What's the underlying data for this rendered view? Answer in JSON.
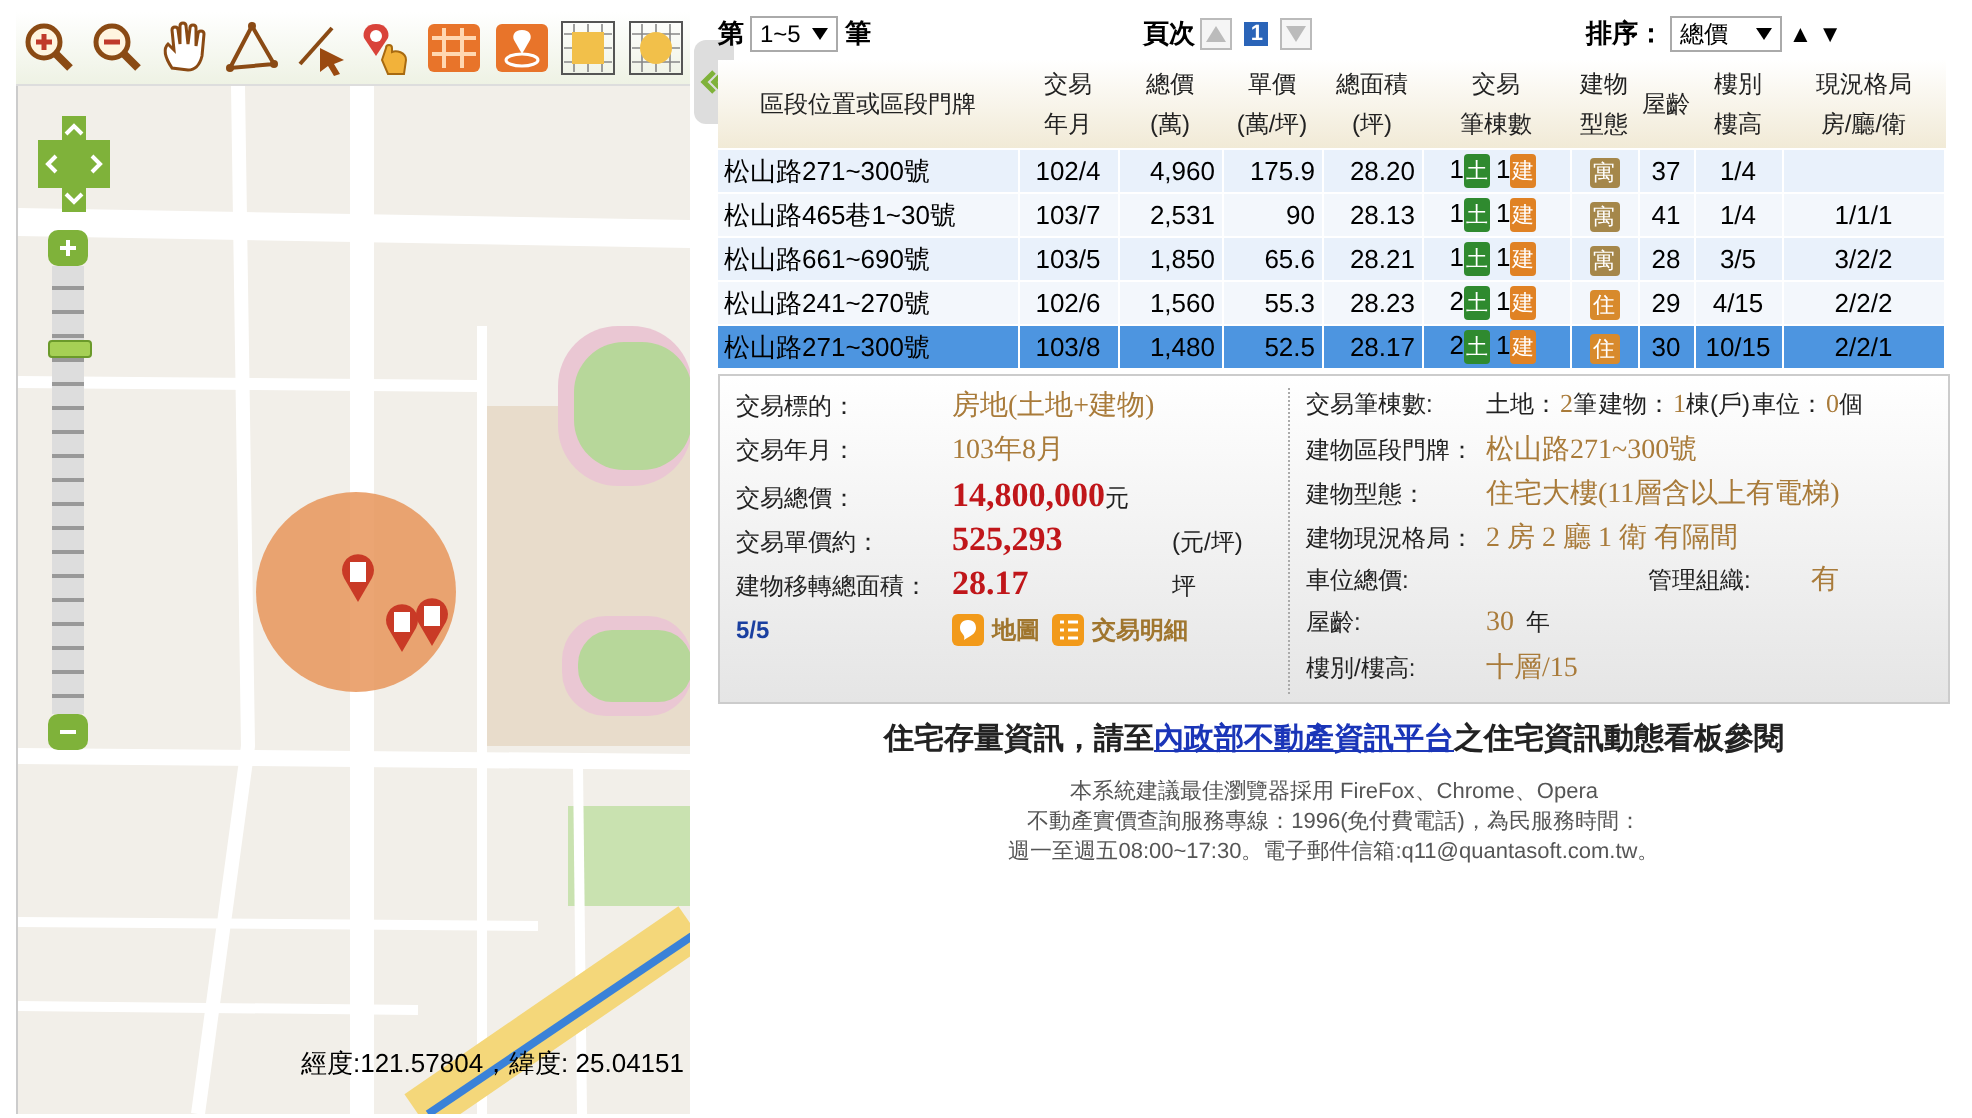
{
  "map": {
    "zoom_slider": {
      "level": 0.83
    },
    "coordinates": "經度:121.57804，緯度: 25.04151"
  },
  "listing_controls": {
    "page_size": {
      "prefix": "第",
      "value": "1~5",
      "suffix": "筆"
    },
    "pager": {
      "label": "頁次",
      "current": "1"
    },
    "sort": {
      "label": "排序：",
      "value": "總價",
      "glyphs": [
        "▲",
        "▼"
      ]
    }
  },
  "table": {
    "columns": [
      [
        "區段位置或區段門牌"
      ],
      [
        "交易",
        "年月"
      ],
      [
        "總價",
        "(萬)"
      ],
      [
        "單價",
        "(萬/坪)"
      ],
      [
        "總面積",
        "(坪)"
      ],
      [
        "交易",
        "筆棟數"
      ],
      [
        "建物",
        "型態"
      ],
      [
        "屋齡"
      ],
      [
        "樓別",
        "樓高"
      ],
      [
        "現況格局",
        "房/廳/衛"
      ]
    ],
    "rows": [
      {
        "selected": false,
        "address": "松山路271~300號",
        "date": "102/4",
        "total": "4,960",
        "unit_price": "175.9",
        "area": "28.20",
        "land": {
          "count": "1",
          "badge": "土"
        },
        "building": {
          "count": "1",
          "badge": "建"
        },
        "type": {
          "text": "寓",
          "color": "#a5874a"
        },
        "age": "37",
        "floor": "1/4",
        "layout": ""
      },
      {
        "selected": false,
        "address": "松山路465巷1~30號",
        "date": "103/7",
        "total": "2,531",
        "unit_price": "90",
        "area": "28.13",
        "land": {
          "count": "1",
          "badge": "土"
        },
        "building": {
          "count": "1",
          "badge": "建"
        },
        "type": {
          "text": "寓",
          "color": "#a5874a"
        },
        "age": "41",
        "floor": "1/4",
        "layout": "1/1/1"
      },
      {
        "selected": false,
        "address": "松山路661~690號",
        "date": "103/5",
        "total": "1,850",
        "unit_price": "65.6",
        "area": "28.21",
        "land": {
          "count": "1",
          "badge": "土"
        },
        "building": {
          "count": "1",
          "badge": "建"
        },
        "type": {
          "text": "寓",
          "color": "#a5874a"
        },
        "age": "28",
        "floor": "3/5",
        "layout": "3/2/2"
      },
      {
        "selected": false,
        "address": "松山路241~270號",
        "date": "102/6",
        "total": "1,560",
        "unit_price": "55.3",
        "area": "28.23",
        "land": {
          "count": "2",
          "badge": "土"
        },
        "building": {
          "count": "1",
          "badge": "建"
        },
        "type": {
          "text": "住",
          "color": "#d88a2c"
        },
        "age": "29",
        "floor": "4/15",
        "layout": "2/2/2"
      },
      {
        "selected": true,
        "address": "松山路271~300號",
        "date": "103/8",
        "total": "1,480",
        "unit_price": "52.5",
        "area": "28.17",
        "land": {
          "count": "2",
          "badge": "土"
        },
        "building": {
          "count": "1",
          "badge": "建"
        },
        "type": {
          "text": "住",
          "color": "#d88a2c"
        },
        "age": "30",
        "floor": "10/15",
        "layout": "2/2/1"
      }
    ]
  },
  "details": {
    "left": [
      {
        "kind": "plain",
        "label": "交易標的：",
        "value": "房地(土地+建物)"
      },
      {
        "kind": "plain",
        "label": "交易年月：",
        "value": "103年8月"
      },
      {
        "kind": "big",
        "label": "交易總價：",
        "value": "14,800,000",
        "unit": "元"
      },
      {
        "kind": "big",
        "label": "交易單價約：",
        "value": "525,293",
        "unit": "(元/坪)"
      },
      {
        "kind": "big",
        "label": "建物移轉總面積：",
        "value": "28.17",
        "unit": "坪"
      }
    ],
    "record": "5/5",
    "links": [
      "地圖",
      "交易明細"
    ],
    "right": [
      {
        "kind": "counts",
        "label": "交易筆棟數:",
        "parts": [
          {
            "label": "土地：",
            "value": "2",
            "unit": "筆"
          },
          {
            "label": "建物：",
            "value": "1",
            "unit": "棟(戶)"
          },
          {
            "label": "車位：",
            "value": "0",
            "unit": "個"
          }
        ]
      },
      {
        "kind": "plain",
        "label": "建物區段門牌：",
        "value": "松山路271~300號"
      },
      {
        "kind": "plain",
        "label": "建物型態：",
        "value": "住宅大樓(11層含以上有電梯)"
      },
      {
        "kind": "plain",
        "label": "建物現況格局：",
        "value": "2 房 2 廳 1 衛 有隔間"
      },
      {
        "kind": "pair",
        "label": "車位總價:",
        "extra_label": "管理組織:",
        "extra_value": "有"
      },
      {
        "kind": "unit",
        "label": "屋齡:",
        "value": "30",
        "unit": "年"
      },
      {
        "kind": "plain",
        "label": "樓別/樓高:",
        "value": "十層/15"
      }
    ]
  },
  "notice": {
    "before": "住宅存量資訊，請至",
    "link": "內政部不動產資訊平台",
    "after": "之住宅資訊動態看板參閱"
  },
  "footer_lines": [
    "本系統建議最佳瀏覽器採用 FireFox、Chrome、Opera",
    "不動產實價查詢服務專線：1996(免付費電話)，為民服務時間：",
    "週一至週五08:00~17:30。電子郵件信箱:q11@quantasoft.com.tw。"
  ]
}
